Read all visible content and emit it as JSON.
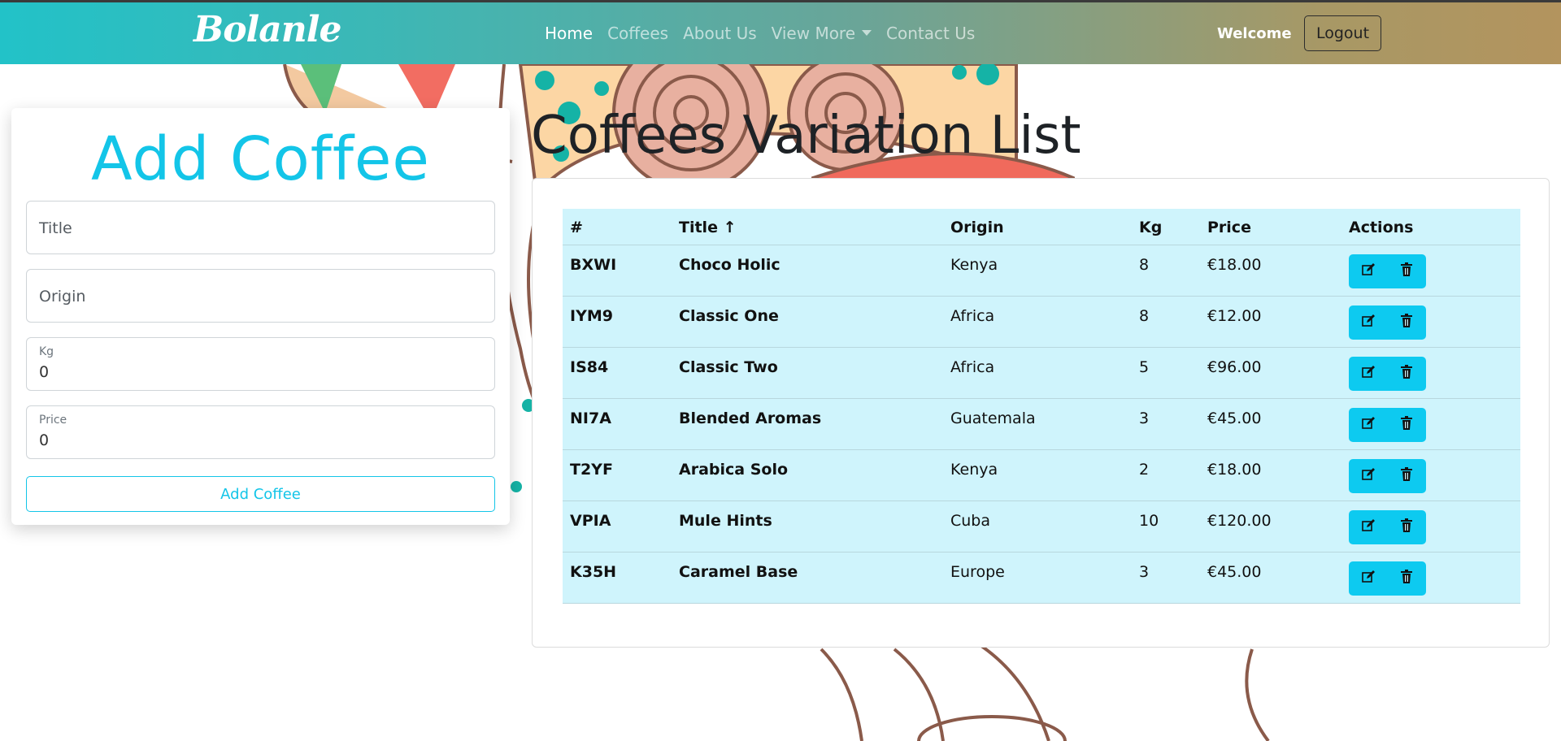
{
  "navbar": {
    "brand": "Bolanle",
    "links": [
      {
        "label": "Home",
        "active": true
      },
      {
        "label": "Coffees",
        "active": false
      },
      {
        "label": "About Us",
        "active": false
      },
      {
        "label": "View More",
        "active": false,
        "dropdown": true
      },
      {
        "label": "Contact Us",
        "active": false
      }
    ],
    "welcome": "Welcome",
    "logout_label": "Logout"
  },
  "add_form": {
    "heading": "Add Coffee",
    "title_placeholder": "Title",
    "origin_placeholder": "Origin",
    "kg_label": "Kg",
    "kg_value": "0",
    "price_label": "Price",
    "price_value": "0",
    "submit_label": "Add Coffee"
  },
  "list": {
    "heading": "Coffees Variation List",
    "columns": [
      "#",
      "Title ↑",
      "Origin",
      "Kg",
      "Price",
      "Actions"
    ],
    "rows": [
      {
        "id": "BXWI",
        "title": "Choco Holic",
        "origin": "Kenya",
        "kg": "8",
        "price": "€18.00"
      },
      {
        "id": "IYM9",
        "title": "Classic One",
        "origin": "Africa",
        "kg": "8",
        "price": "€12.00"
      },
      {
        "id": "IS84",
        "title": "Classic Two",
        "origin": "Africa",
        "kg": "5",
        "price": "€96.00"
      },
      {
        "id": "NI7A",
        "title": "Blended Aromas",
        "origin": "Guatemala",
        "kg": "3",
        "price": "€45.00"
      },
      {
        "id": "T2YF",
        "title": "Arabica Solo",
        "origin": "Kenya",
        "kg": "2",
        "price": "€18.00"
      },
      {
        "id": "VPIA",
        "title": "Mule Hints",
        "origin": "Cuba",
        "kg": "10",
        "price": "€120.00"
      },
      {
        "id": "K35H",
        "title": "Caramel Base",
        "origin": "Europe",
        "kg": "3",
        "price": "€45.00"
      }
    ],
    "row_actions": [
      "edit-icon",
      "trash-icon"
    ]
  },
  "colors": {
    "accent": "#13c5e8",
    "action_button": "#0dcaf0",
    "table_bg": "#cff4fc"
  }
}
